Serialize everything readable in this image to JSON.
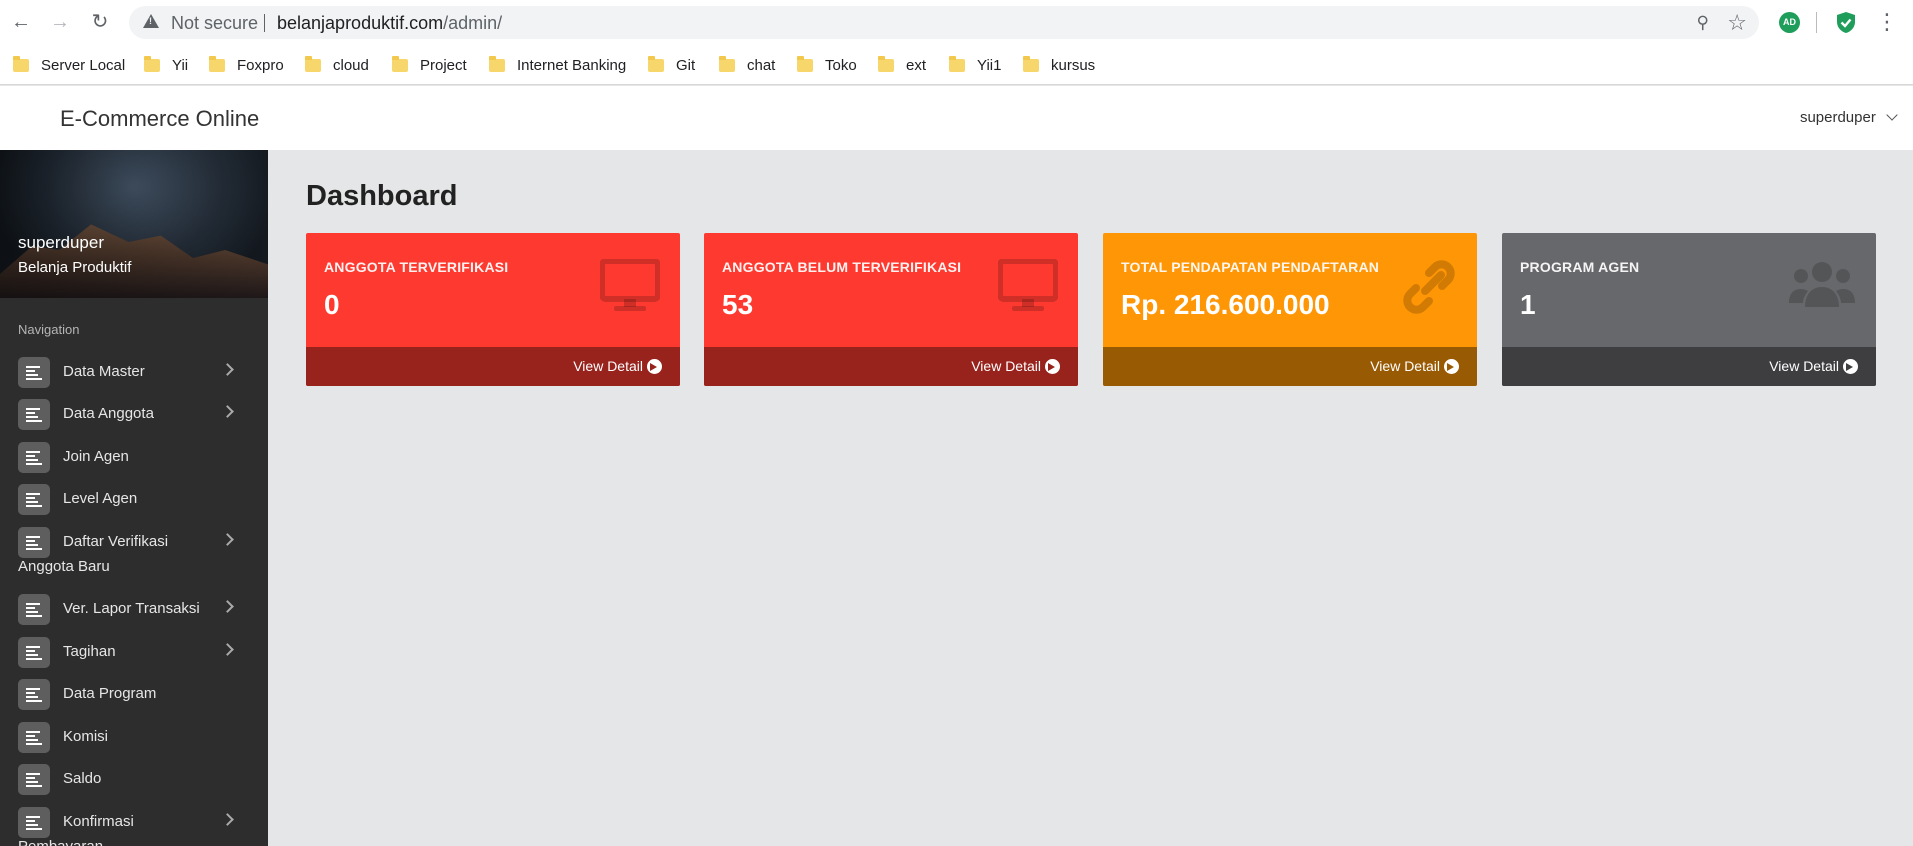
{
  "browser": {
    "security": "Not secure",
    "url_host": "belanjaproduktif.com",
    "url_path": "/admin/",
    "extension_badge": "AD",
    "bookmarks": [
      "Server Local",
      "Yii",
      "Foxpro",
      "cloud",
      "Project",
      "Internet Banking",
      "Git",
      "chat",
      "Toko",
      "ext",
      "Yii1",
      "kursus"
    ]
  },
  "header": {
    "brand": "E-Commerce Online",
    "user": "superduper"
  },
  "sidebar": {
    "name": "superduper",
    "role": "Belanja Produktif",
    "nav_heading": "Navigation",
    "items": [
      {
        "label": "Data Master",
        "label2": "",
        "has_submenu": true
      },
      {
        "label": "Data Anggota",
        "label2": "",
        "has_submenu": true
      },
      {
        "label": "Join Agen",
        "label2": "",
        "has_submenu": false
      },
      {
        "label": "Level Agen",
        "label2": "",
        "has_submenu": false
      },
      {
        "label": "Daftar Verifikasi",
        "label2": "Anggota Baru",
        "has_submenu": true
      },
      {
        "label": "Ver. Lapor Transaksi",
        "label2": "",
        "has_submenu": true
      },
      {
        "label": "Tagihan",
        "label2": "",
        "has_submenu": true
      },
      {
        "label": "Data Program",
        "label2": "",
        "has_submenu": false
      },
      {
        "label": "Komisi",
        "label2": "",
        "has_submenu": false
      },
      {
        "label": "Saldo",
        "label2": "",
        "has_submenu": false
      },
      {
        "label": "Konfirmasi",
        "label2": "Pembayaran",
        "has_submenu": true
      }
    ]
  },
  "main": {
    "title": "Dashboard",
    "cards": [
      {
        "title": "ANGGOTA TERVERIFIKASI",
        "value": "0",
        "link": "View Detail",
        "icon": "monitor-icon",
        "color": "#fe3a30",
        "footer_color": "#98221c"
      },
      {
        "title": "ANGGOTA BELUM TERVERIFIKASI",
        "value": "53",
        "link": "View Detail",
        "icon": "monitor-icon",
        "color": "#fe3a30",
        "footer_color": "#98221c"
      },
      {
        "title": "TOTAL PENDAPATAN PENDAFTARAN",
        "value": "Rp. 216.600.000",
        "link": "View Detail",
        "icon": "link-icon",
        "color": "#ff9606",
        "footer_color": "#995a04"
      },
      {
        "title": "PROGRAM AGEN",
        "value": "1",
        "link": "View Detail",
        "icon": "users-icon",
        "color": "#67686b",
        "footer_color": "#3e3e40"
      }
    ]
  }
}
